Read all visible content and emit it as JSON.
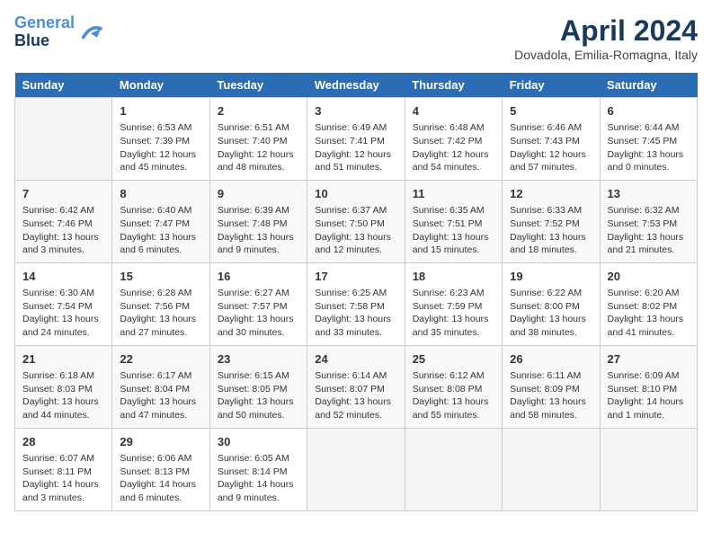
{
  "header": {
    "logo_line1": "General",
    "logo_line2": "Blue",
    "month_title": "April 2024",
    "location": "Dovadola, Emilia-Romagna, Italy"
  },
  "days_of_week": [
    "Sunday",
    "Monday",
    "Tuesday",
    "Wednesday",
    "Thursday",
    "Friday",
    "Saturday"
  ],
  "weeks": [
    [
      {
        "day": "",
        "empty": true
      },
      {
        "day": "1",
        "sunrise": "6:53 AM",
        "sunset": "7:39 PM",
        "daylight": "12 hours and 45 minutes."
      },
      {
        "day": "2",
        "sunrise": "6:51 AM",
        "sunset": "7:40 PM",
        "daylight": "12 hours and 48 minutes."
      },
      {
        "day": "3",
        "sunrise": "6:49 AM",
        "sunset": "7:41 PM",
        "daylight": "12 hours and 51 minutes."
      },
      {
        "day": "4",
        "sunrise": "6:48 AM",
        "sunset": "7:42 PM",
        "daylight": "12 hours and 54 minutes."
      },
      {
        "day": "5",
        "sunrise": "6:46 AM",
        "sunset": "7:43 PM",
        "daylight": "12 hours and 57 minutes."
      },
      {
        "day": "6",
        "sunrise": "6:44 AM",
        "sunset": "7:45 PM",
        "daylight": "13 hours and 0 minutes."
      }
    ],
    [
      {
        "day": "7",
        "sunrise": "6:42 AM",
        "sunset": "7:46 PM",
        "daylight": "13 hours and 3 minutes."
      },
      {
        "day": "8",
        "sunrise": "6:40 AM",
        "sunset": "7:47 PM",
        "daylight": "13 hours and 6 minutes."
      },
      {
        "day": "9",
        "sunrise": "6:39 AM",
        "sunset": "7:48 PM",
        "daylight": "13 hours and 9 minutes."
      },
      {
        "day": "10",
        "sunrise": "6:37 AM",
        "sunset": "7:50 PM",
        "daylight": "13 hours and 12 minutes."
      },
      {
        "day": "11",
        "sunrise": "6:35 AM",
        "sunset": "7:51 PM",
        "daylight": "13 hours and 15 minutes."
      },
      {
        "day": "12",
        "sunrise": "6:33 AM",
        "sunset": "7:52 PM",
        "daylight": "13 hours and 18 minutes."
      },
      {
        "day": "13",
        "sunrise": "6:32 AM",
        "sunset": "7:53 PM",
        "daylight": "13 hours and 21 minutes."
      }
    ],
    [
      {
        "day": "14",
        "sunrise": "6:30 AM",
        "sunset": "7:54 PM",
        "daylight": "13 hours and 24 minutes."
      },
      {
        "day": "15",
        "sunrise": "6:28 AM",
        "sunset": "7:56 PM",
        "daylight": "13 hours and 27 minutes."
      },
      {
        "day": "16",
        "sunrise": "6:27 AM",
        "sunset": "7:57 PM",
        "daylight": "13 hours and 30 minutes."
      },
      {
        "day": "17",
        "sunrise": "6:25 AM",
        "sunset": "7:58 PM",
        "daylight": "13 hours and 33 minutes."
      },
      {
        "day": "18",
        "sunrise": "6:23 AM",
        "sunset": "7:59 PM",
        "daylight": "13 hours and 35 minutes."
      },
      {
        "day": "19",
        "sunrise": "6:22 AM",
        "sunset": "8:00 PM",
        "daylight": "13 hours and 38 minutes."
      },
      {
        "day": "20",
        "sunrise": "6:20 AM",
        "sunset": "8:02 PM",
        "daylight": "13 hours and 41 minutes."
      }
    ],
    [
      {
        "day": "21",
        "sunrise": "6:18 AM",
        "sunset": "8:03 PM",
        "daylight": "13 hours and 44 minutes."
      },
      {
        "day": "22",
        "sunrise": "6:17 AM",
        "sunset": "8:04 PM",
        "daylight": "13 hours and 47 minutes."
      },
      {
        "day": "23",
        "sunrise": "6:15 AM",
        "sunset": "8:05 PM",
        "daylight": "13 hours and 50 minutes."
      },
      {
        "day": "24",
        "sunrise": "6:14 AM",
        "sunset": "8:07 PM",
        "daylight": "13 hours and 52 minutes."
      },
      {
        "day": "25",
        "sunrise": "6:12 AM",
        "sunset": "8:08 PM",
        "daylight": "13 hours and 55 minutes."
      },
      {
        "day": "26",
        "sunrise": "6:11 AM",
        "sunset": "8:09 PM",
        "daylight": "13 hours and 58 minutes."
      },
      {
        "day": "27",
        "sunrise": "6:09 AM",
        "sunset": "8:10 PM",
        "daylight": "14 hours and 1 minute."
      }
    ],
    [
      {
        "day": "28",
        "sunrise": "6:07 AM",
        "sunset": "8:11 PM",
        "daylight": "14 hours and 3 minutes."
      },
      {
        "day": "29",
        "sunrise": "6:06 AM",
        "sunset": "8:13 PM",
        "daylight": "14 hours and 6 minutes."
      },
      {
        "day": "30",
        "sunrise": "6:05 AM",
        "sunset": "8:14 PM",
        "daylight": "14 hours and 9 minutes."
      },
      {
        "day": "",
        "empty": true
      },
      {
        "day": "",
        "empty": true
      },
      {
        "day": "",
        "empty": true
      },
      {
        "day": "",
        "empty": true
      }
    ]
  ],
  "labels": {
    "sunrise_label": "Sunrise:",
    "sunset_label": "Sunset:",
    "daylight_label": "Daylight:"
  }
}
